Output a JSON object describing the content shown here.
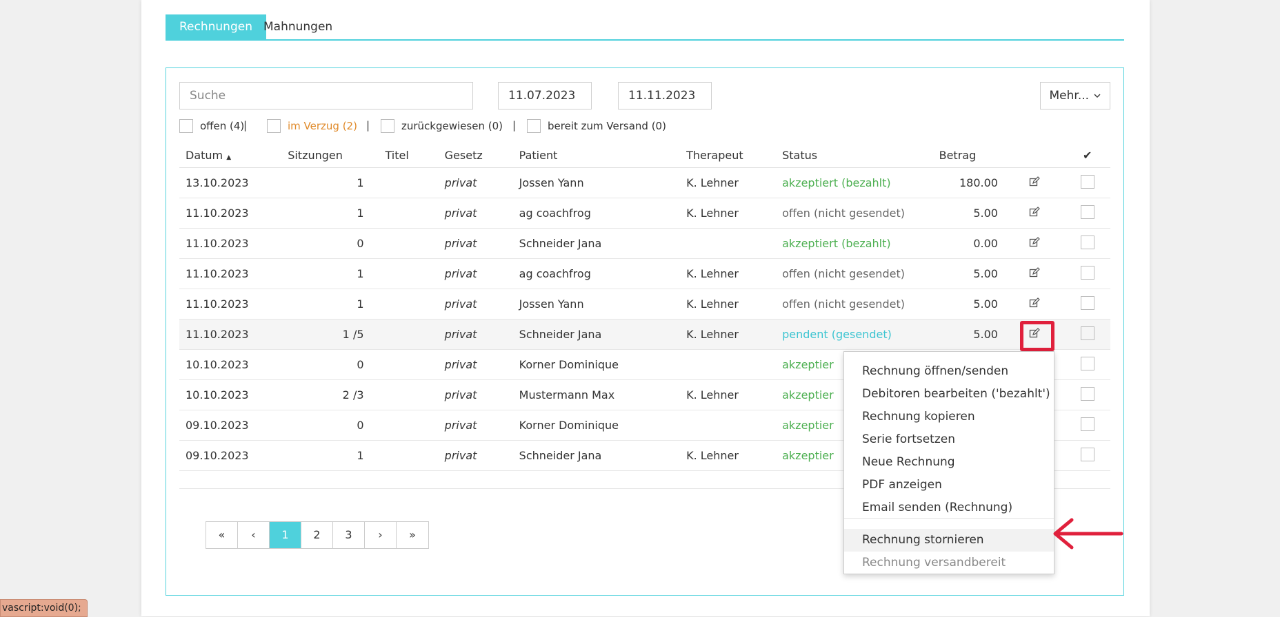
{
  "tabs": [
    {
      "label": "Rechnungen",
      "active": true
    },
    {
      "label": "Mahnungen",
      "active": false
    }
  ],
  "filters": {
    "search_placeholder": "Suche",
    "date_from": "11.07.2023",
    "date_to": "11.11.2023",
    "more_label": "Mehr...",
    "checkboxes": [
      {
        "label": "offen (4)"
      },
      {
        "label": "im Verzug (2)",
        "color": "#e08a2a"
      },
      {
        "label": "zurückgewiesen (0)"
      },
      {
        "label": "bereit zum Versand (0)"
      }
    ],
    "separator": "|"
  },
  "table": {
    "headers": {
      "datum": "Datum",
      "sitzungen": "Sitzungen",
      "titel": "Titel",
      "gesetz": "Gesetz",
      "patient": "Patient",
      "therapeut": "Therapeut",
      "status": "Status",
      "betrag": "Betrag",
      "check": "✔"
    },
    "sort_indicator": "▲",
    "rows": [
      {
        "datum": "13.10.2023",
        "sitzungen": "1",
        "gesetz": "privat",
        "patient": "Jossen Yann",
        "therapeut": "K. Lehner",
        "status": "akzeptiert (bezahlt)",
        "status_color": "green",
        "betrag": "180.00"
      },
      {
        "datum": "11.10.2023",
        "sitzungen": "1",
        "gesetz": "privat",
        "patient": "ag coachfrog",
        "therapeut": "K. Lehner",
        "status": "offen (nicht gesendet)",
        "status_color": "grey",
        "betrag": "5.00"
      },
      {
        "datum": "11.10.2023",
        "sitzungen": "0",
        "gesetz": "privat",
        "patient": "Schneider Jana",
        "therapeut": "",
        "status": "akzeptiert (bezahlt)",
        "status_color": "green",
        "betrag": "0.00"
      },
      {
        "datum": "11.10.2023",
        "sitzungen": "1",
        "gesetz": "privat",
        "patient": "ag coachfrog",
        "therapeut": "K. Lehner",
        "status": "offen (nicht gesendet)",
        "status_color": "grey",
        "betrag": "5.00"
      },
      {
        "datum": "11.10.2023",
        "sitzungen": "1",
        "gesetz": "privat",
        "patient": "Jossen Yann",
        "therapeut": "K. Lehner",
        "status": "offen (nicht gesendet)",
        "status_color": "grey",
        "betrag": "5.00"
      },
      {
        "datum": "11.10.2023",
        "sitzungen": "1 /5",
        "gesetz": "privat",
        "patient": "Schneider Jana",
        "therapeut": "K. Lehner",
        "status": "pendent (gesendet)",
        "status_color": "cyan",
        "betrag": "5.00",
        "highlight": true
      },
      {
        "datum": "10.10.2023",
        "sitzungen": "0",
        "gesetz": "privat",
        "patient": "Korner Dominique",
        "therapeut": "",
        "status": "akzeptier",
        "status_color": "green",
        "betrag": ""
      },
      {
        "datum": "10.10.2023",
        "sitzungen": "2 /3",
        "gesetz": "privat",
        "patient": "Mustermann Max",
        "therapeut": "K. Lehner",
        "status": "akzeptier",
        "status_color": "green",
        "betrag": ""
      },
      {
        "datum": "09.10.2023",
        "sitzungen": "0",
        "gesetz": "privat",
        "patient": "Korner Dominique",
        "therapeut": "",
        "status": "akzeptier",
        "status_color": "green",
        "betrag": ""
      },
      {
        "datum": "09.10.2023",
        "sitzungen": "1",
        "gesetz": "privat",
        "patient": "Schneider Jana",
        "therapeut": "K. Lehner",
        "status": "akzeptier",
        "status_color": "green",
        "betrag": ""
      }
    ]
  },
  "pagination": {
    "items": [
      "«",
      "‹",
      "1",
      "2",
      "3",
      "›",
      "»"
    ],
    "active": "1"
  },
  "context_menu": {
    "items": [
      "Rechnung öffnen/senden",
      "Debitoren bearbeiten ('bezahlt')",
      "Rechnung kopieren",
      "Serie fortsetzen",
      "Neue Rechnung",
      "PDF anzeigen",
      "Email senden (Rechnung)"
    ],
    "items_after_divider": [
      {
        "label": "Rechnung stornieren",
        "hover": true
      },
      {
        "label": "Rechnung versandbereit",
        "disabled": true
      }
    ]
  },
  "status_bar": "vascript:void(0);",
  "colors": {
    "accent": "#4fd1dc",
    "annotation_red": "#e0203c",
    "status_green": "#4caf50",
    "status_cyan": "#3cc4d1",
    "overdue_orange": "#e08a2a"
  }
}
